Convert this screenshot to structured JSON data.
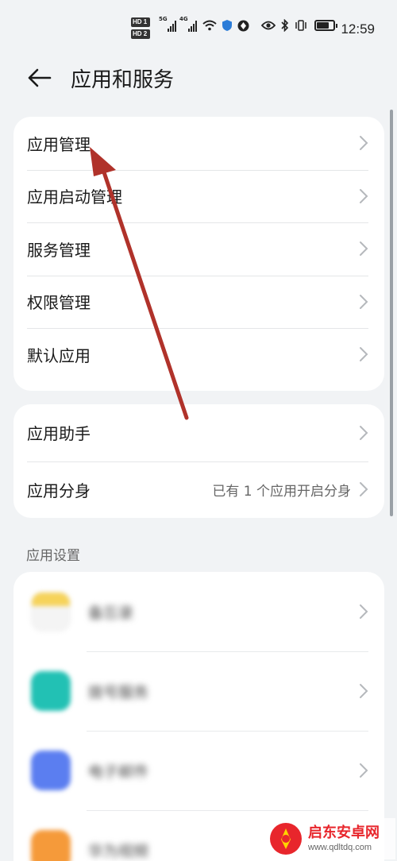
{
  "status_bar": {
    "time": "12:59",
    "hd1": "HD 1",
    "hd2": "HD 2",
    "net1": "5G",
    "net2": "4G",
    "icons": [
      "signal-icon",
      "signal-icon",
      "wifi-icon",
      "shield-icon",
      "vpn-icon",
      "eye-icon",
      "bluetooth-icon",
      "vibrate-icon",
      "battery-icon"
    ],
    "battery_level": 0.7
  },
  "header": {
    "title": "应用和服务",
    "back_icon": "back-arrow-icon"
  },
  "group1": {
    "items": [
      {
        "label": "应用管理"
      },
      {
        "label": "应用启动管理"
      },
      {
        "label": "服务管理"
      },
      {
        "label": "权限管理"
      },
      {
        "label": "默认应用"
      }
    ]
  },
  "group2": {
    "items": [
      {
        "label": "应用助手",
        "value": ""
      },
      {
        "label": "应用分身",
        "value": "已有 1 个应用开启分身"
      }
    ]
  },
  "app_settings": {
    "section_title": "应用设置",
    "apps": [
      {
        "label": "备忘录",
        "icon": "notes-app-icon",
        "color": "#f6d35a"
      },
      {
        "label": "拨号服务",
        "icon": "phone-app-icon",
        "color": "#22c1b4"
      },
      {
        "label": "电子邮件",
        "icon": "email-app-icon",
        "color": "#5b7ef0"
      },
      {
        "label": "华为视频",
        "icon": "video-app-icon",
        "color": "#f59a3a"
      }
    ]
  },
  "colors": {
    "background": "#f1f3f5",
    "card": "#ffffff",
    "annotation_arrow": "#b0322a"
  },
  "watermark": {
    "name": "启东安卓网",
    "url": "www.qdltdq.com"
  }
}
